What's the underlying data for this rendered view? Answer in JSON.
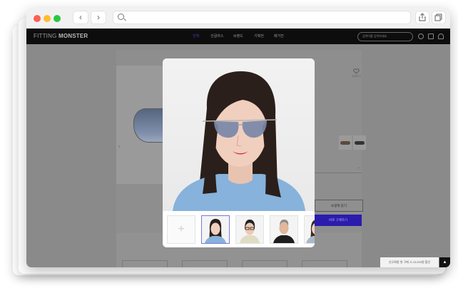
{
  "browser": {
    "back_label": "‹",
    "forward_label": "›",
    "controls": [
      "share-icon",
      "tabs-icon"
    ],
    "traffic_lights": [
      "#fd5f57",
      "#febc2e",
      "#28c840"
    ]
  },
  "site": {
    "logo_light": "FITTING",
    "logo_bold": "MONSTER",
    "menu": [
      "전체",
      "선글라스",
      "브랜드",
      "기획전",
      "매거진"
    ],
    "search_placeholder": "검색어를 입력하세요",
    "header_icons": [
      "heart-icon",
      "cart-icon",
      "user-icon"
    ]
  },
  "product": {
    "wish_label": "저장하기",
    "add_cart_label": "쇼핑백 담기",
    "buy_label": "바로 구매하기",
    "promo_text": "신규회원 첫 구매 시 10,000원 할인",
    "top_label": "▲"
  },
  "modal": {
    "add_label": "+",
    "thumbnails": [
      "add-photo",
      "young-woman",
      "woman-glasses",
      "older-man",
      "woman-partial"
    ],
    "selected_index": 1
  },
  "colors": {
    "accent": "#2b1cae",
    "topbar": "#0d0d0d",
    "shirt": "#86b2db"
  }
}
